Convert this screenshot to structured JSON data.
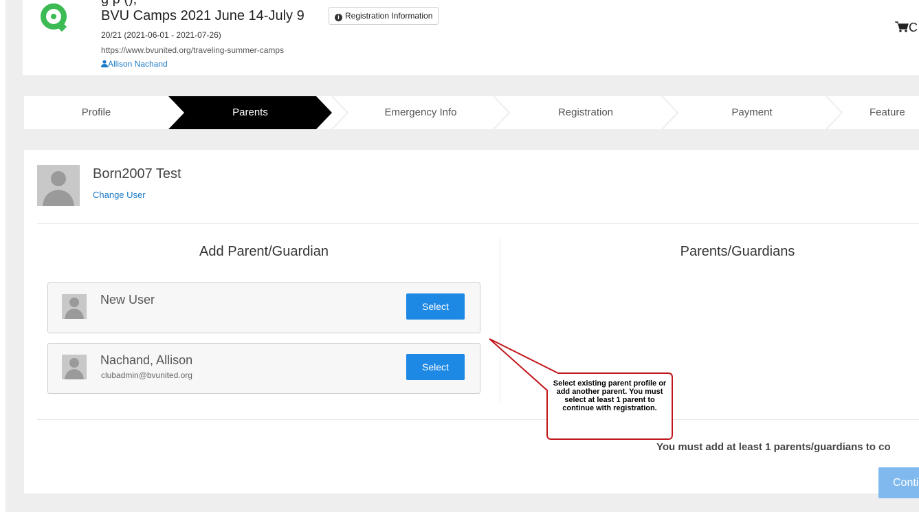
{
  "header": {
    "clipped_title": "g p (),",
    "event_title": "BVU Camps 2021 June 14-July 9",
    "registration_info_label": "Registration Information",
    "season": "20/21 (2021-06-01 - 2021-07-26)",
    "url": "https://www.bvunited.org/traveling-summer-camps",
    "user_name": "Allison Nachand",
    "cart_label": "C",
    "brand_color": "#3cba54"
  },
  "steps": [
    {
      "label": "Profile",
      "active": false
    },
    {
      "label": "Parents",
      "active": true
    },
    {
      "label": "Emergency Info",
      "active": false
    },
    {
      "label": "Registration",
      "active": false
    },
    {
      "label": "Payment",
      "active": false
    },
    {
      "label": "Feature",
      "active": false
    }
  ],
  "participant": {
    "name": "Born2007 Test",
    "change_user_label": "Change User"
  },
  "add_parent": {
    "title": "Add Parent/Guardian",
    "options": [
      {
        "name": "New User",
        "email": "",
        "select_label": "Select"
      },
      {
        "name": "Nachand, Allison",
        "email": "clubadmin@bvunited.org",
        "select_label": "Select"
      }
    ]
  },
  "parents_list": {
    "title": "Parents/Guardians"
  },
  "footer": {
    "requirement_text": "You must add at least 1 parents/guardians to co",
    "continue_label": "Conti"
  },
  "callout": {
    "text": "Select existing parent profile or add another parent. You must select at least 1 parent to continue with registration.",
    "border_color": "#c0161b"
  },
  "colors": {
    "accent": "#1e88e5",
    "link": "#1b7ac8",
    "active_step": "#000000",
    "continue_disabled": "#7fb9ee"
  }
}
